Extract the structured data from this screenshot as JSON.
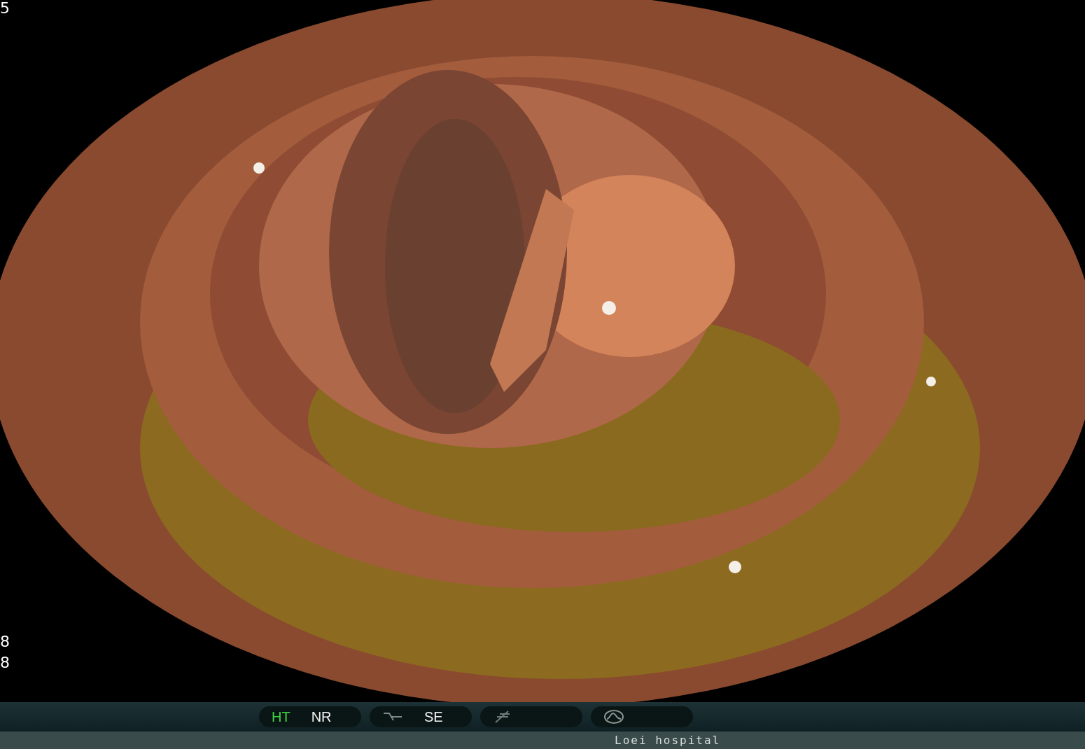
{
  "video": {
    "top_left_numbers": [
      "5"
    ],
    "bottom_left_numbers": [
      "8",
      "8"
    ]
  },
  "status_bar": {
    "groups": [
      {
        "kind": "plain",
        "labels": [
          {
            "text": "HT",
            "on": true
          },
          {
            "text": "NR",
            "on": false
          }
        ]
      },
      {
        "kind": "curve",
        "labels": [
          {
            "text": "SE",
            "on": false
          }
        ]
      },
      {
        "kind": "slash"
      },
      {
        "kind": "wave"
      }
    ]
  },
  "footer": {
    "text": "Loei hospital"
  }
}
